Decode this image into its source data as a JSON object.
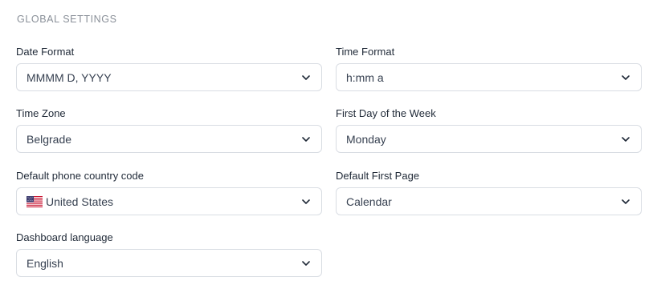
{
  "section": {
    "title": "GLOBAL SETTINGS"
  },
  "fields": {
    "date_format": {
      "label": "Date Format",
      "value": "MMMM D, YYYY"
    },
    "time_format": {
      "label": "Time Format",
      "value": "h:mm a"
    },
    "time_zone": {
      "label": "Time Zone",
      "value": "Belgrade"
    },
    "first_day": {
      "label": "First Day of the Week",
      "value": "Monday"
    },
    "phone_code": {
      "label": "Default phone country code",
      "value": "United States",
      "flag_icon": "us-flag-icon"
    },
    "first_page": {
      "label": "Default First Page",
      "value": "Calendar"
    },
    "language": {
      "label": "Dashboard language",
      "value": "English"
    }
  },
  "icons": {
    "chevron": "chevron-down-icon"
  },
  "colors": {
    "border": "#d9dde3",
    "section_title": "#8a9099"
  }
}
